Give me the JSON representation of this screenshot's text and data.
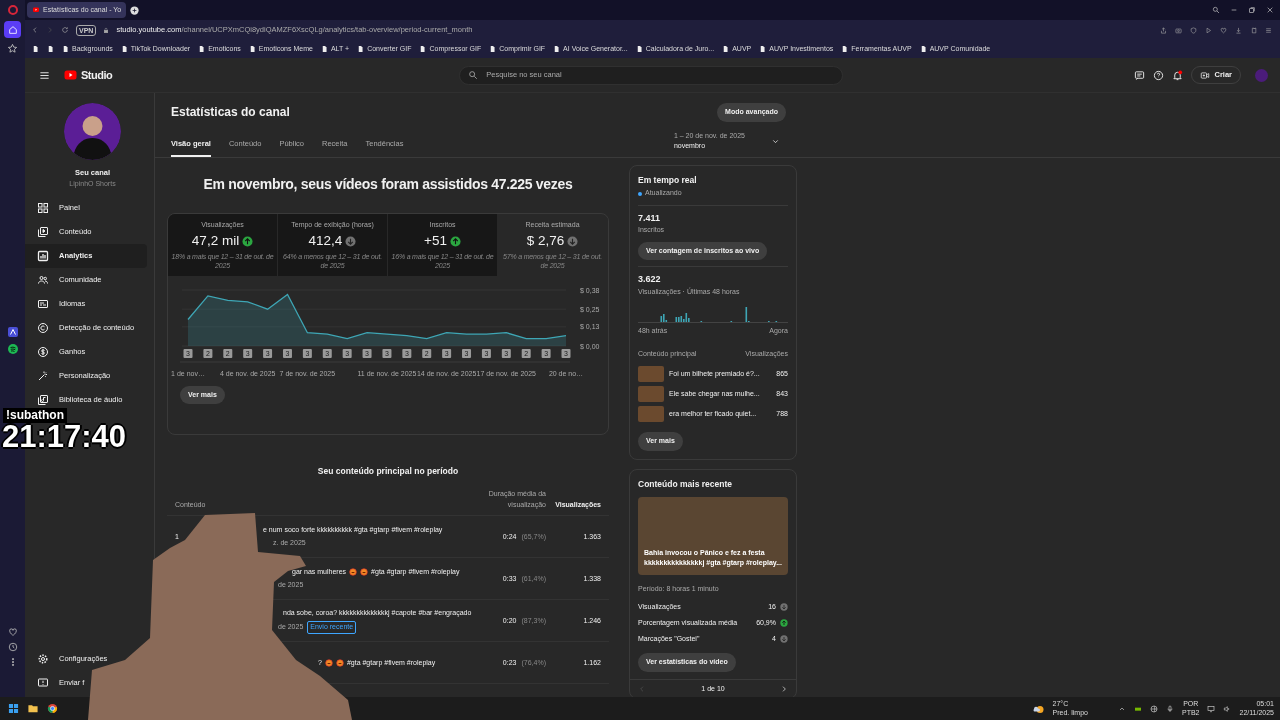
{
  "browser": {
    "tabs": [
      {
        "title": "Estatísticas do canal - Yo",
        "selected": true
      }
    ],
    "address": {
      "vpn_badge": "VPN",
      "url_host": "studio.youtube.com",
      "url_path": "/channel/UCPXmCQi8ydiQAMZF6XscQLg/analytics/tab-overview/period-current_month"
    },
    "bookmarks": [
      {
        "kind": "icon"
      },
      {
        "kind": "icon"
      },
      {
        "kind": "link",
        "label": "Backgrounds"
      },
      {
        "kind": "link",
        "label": "TikTok Downloader"
      },
      {
        "kind": "link",
        "label": "Emoticons"
      },
      {
        "kind": "link",
        "label": "Emoticons Meme"
      },
      {
        "kind": "link",
        "label": "ALT +"
      },
      {
        "kind": "link",
        "label": "Converter GIF"
      },
      {
        "kind": "link",
        "label": "Compressor GIF"
      },
      {
        "kind": "link",
        "label": "Comprimir GIF"
      },
      {
        "kind": "link",
        "label": "AI Voice Generator..."
      },
      {
        "kind": "link",
        "label": "Calculadora de Juro..."
      },
      {
        "kind": "link",
        "label": "AUVP"
      },
      {
        "kind": "link",
        "label": "AUVP Investimentos"
      },
      {
        "kind": "link",
        "label": "Ferramentas AUVP"
      },
      {
        "kind": "link",
        "label": "AUVP Comunidade"
      }
    ]
  },
  "header": {
    "logo_text": "Studio",
    "search_placeholder": "Pesquise no seu canal",
    "create_button": "Criar"
  },
  "sidebar": {
    "channel_name": "Seu canal",
    "channel_handle": "LipinhO Shorts",
    "items": [
      {
        "label": "Painel",
        "selected": false
      },
      {
        "label": "Conteúdo",
        "selected": false
      },
      {
        "label": "Analytics",
        "selected": true
      },
      {
        "label": "Comunidade",
        "selected": false
      },
      {
        "label": "Idiomas",
        "selected": false
      },
      {
        "label": "Detecção de conteúdo",
        "selected": false
      },
      {
        "label": "Ganhos",
        "selected": false
      },
      {
        "label": "Personalização",
        "selected": false
      },
      {
        "label": "Biblioteca de áudio",
        "selected": false
      }
    ],
    "bottom_items": [
      {
        "label": "Configurações"
      },
      {
        "label": "Enviar f"
      }
    ]
  },
  "main": {
    "title": "Estatísticas do canal",
    "advanced_button": "Modo avançado",
    "tabs": [
      {
        "label": "Visão geral",
        "selected": true
      },
      {
        "label": "Conteúdo",
        "selected": false
      },
      {
        "label": "Público",
        "selected": false
      },
      {
        "label": "Receita",
        "selected": false
      },
      {
        "label": "Tendências",
        "selected": false
      }
    ],
    "date_range": {
      "range": "1 – 20 de nov. de 2025",
      "period": "novembro"
    },
    "headline": "Em novembro, seus vídeos foram assistidos 47.225 vezes",
    "metrics": [
      {
        "label": "Visualizações",
        "value": "47,2 mil",
        "up": true,
        "comparison": "18% a mais que 12 – 31 de out. de 2025",
        "selected": false
      },
      {
        "label": "Tempo de exibição (horas)",
        "value": "412,4",
        "up": false,
        "comparison": "64% a menos que 12 – 31 de out. de 2025",
        "selected": false
      },
      {
        "label": "Inscritos",
        "value": "+51",
        "up": true,
        "comparison": "16% a mais que 12 – 31 de out. de 2025",
        "selected": false
      },
      {
        "label": "Receita estimada",
        "value": "$ 2,76",
        "up": false,
        "comparison": "57% a menos que 12 – 31 de out. de 2025",
        "selected": true
      }
    ],
    "chart_data": {
      "type": "area",
      "categories": [
        "1 de nov…",
        null,
        null,
        "4 de nov. de 2025",
        null,
        null,
        "7 de nov. de 2025",
        null,
        null,
        null,
        "11 de nov. de 2025",
        null,
        null,
        "14 de nov. de 2025",
        null,
        null,
        "17 de nov. de 2025",
        null,
        null,
        "20 de no…"
      ],
      "series": [
        {
          "color": "#3ea6b5",
          "values": [
            0.18,
            0.34,
            0.31,
            0.3,
            0.25,
            0.35,
            0.09,
            0.08,
            0.05,
            0.09,
            0.08,
            0.07,
            0.05,
            0.09,
            0.08,
            0.08,
            0.09,
            0.05,
            0.05,
            0.07
          ]
        }
      ],
      "ylim": [
        0,
        0.38
      ],
      "yticks": [
        {
          "value": 0,
          "label": "$ 0,00"
        },
        {
          "value": 0.13,
          "label": "$ 0,13"
        },
        {
          "value": 0.25,
          "label": "$ 0,25"
        },
        {
          "value": 0.38,
          "label": "$ 0,38"
        }
      ]
    },
    "upload_markers": [
      "3",
      "2",
      "2",
      "3",
      "3",
      "3",
      "3",
      "3",
      "3",
      "3",
      "3",
      "3",
      "2",
      "3",
      "3",
      "3",
      "3",
      "2",
      "3",
      "3"
    ],
    "more_button": "Ver mais",
    "top_content": {
      "title": "Seu conteúdo principal no período",
      "columns": [
        {
          "label": "Conteúdo",
          "sorted": false
        },
        {
          "label": "Duração média da visualização",
          "sorted": false
        },
        {
          "label": "Visualizações",
          "sorted": true
        }
      ],
      "rows": [
        {
          "rank": "1",
          "title_parts": [
            {
              "kind": "text",
              "text": "e num soco forte kkkkkkkkkk #gta #gtarp #fivem #roleplay"
            }
          ],
          "date": "z. de 2025",
          "avg_duration": "0:24",
          "avg_percent": "(65,7%)",
          "views": "1.363"
        },
        {
          "title_parts": [
            {
              "kind": "text",
              "text": "gar nas mulheres"
            },
            {
              "kind": "emoji"
            },
            {
              "kind": "emoji"
            },
            {
              "kind": "text",
              "text": "#gta #gtarp #fivem #roleplay"
            }
          ],
          "date": "de 2025",
          "avg_duration": "0:33",
          "avg_percent": "(61,4%)",
          "views": "1.338"
        },
        {
          "title_parts": [
            {
              "kind": "text",
              "text": "nda sobe, coroa? kkkkkkkkkkkkkkj #capote #bar #engraçado"
            }
          ],
          "date": "de 2025",
          "badge": "Envio recente",
          "avg_duration": "0:20",
          "avg_percent": "(87,3%)",
          "views": "1.246"
        },
        {
          "title_parts": [
            {
              "kind": "text",
              "text": "?"
            },
            {
              "kind": "emoji"
            },
            {
              "kind": "emoji"
            },
            {
              "kind": "text",
              "text": "#gta #gtarp #fivem #roleplay"
            }
          ],
          "avg_duration": "0:23",
          "avg_percent": "(76,4%)",
          "views": "1.162"
        }
      ]
    }
  },
  "realtime": {
    "title": "Em tempo real",
    "status": "Atualizando",
    "subscribers": "7.411",
    "subscribers_label": "Inscritos",
    "live_count_button": "Ver contagem de inscritos ao vivo",
    "views": "3.622",
    "views_label": "Visualizações · Últimas 48 horas",
    "axis_start": "48h atrás",
    "axis_end": "Agora",
    "list_header": "Conteúdo principal",
    "list_header_right": "Visualizações",
    "items": [
      {
        "title": "Foi um bilhete premiado é?...",
        "views": "865"
      },
      {
        "title": "Ele sabe chegar nas mulhe...",
        "views": "843"
      },
      {
        "title": "era melhor ter ficado quiet...",
        "views": "788"
      }
    ],
    "more_button": "Ver mais"
  },
  "latest": {
    "title": "Conteúdo mais recente",
    "video_title": "Bahia invocou o Pânico e fez a festa kkkkkkkkkkkkkkkj #gta #gtarp #roleplay...",
    "period": "Período: 8 horas 1 minuto",
    "stats": [
      {
        "label": "Visualizações",
        "value": "16",
        "up": false
      },
      {
        "label": "Porcentagem visualizada média",
        "value": "60,9%",
        "up": true
      },
      {
        "label": "Marcações \"Gostei\"",
        "value": "4",
        "up": false
      }
    ],
    "stats_button": "Ver estatísticas do vídeo",
    "pager": {
      "label": "1 de 10",
      "prev_enabled": false,
      "next_enabled": true
    }
  },
  "stream_overlay": {
    "tag": "!subathon",
    "timer": "21:17:40"
  },
  "taskbar": {
    "temperature": "27°C",
    "weather": "Pred. limpo",
    "language": "POR",
    "layout": "PTB2",
    "time": "05:01",
    "date": "22/11/2025"
  }
}
